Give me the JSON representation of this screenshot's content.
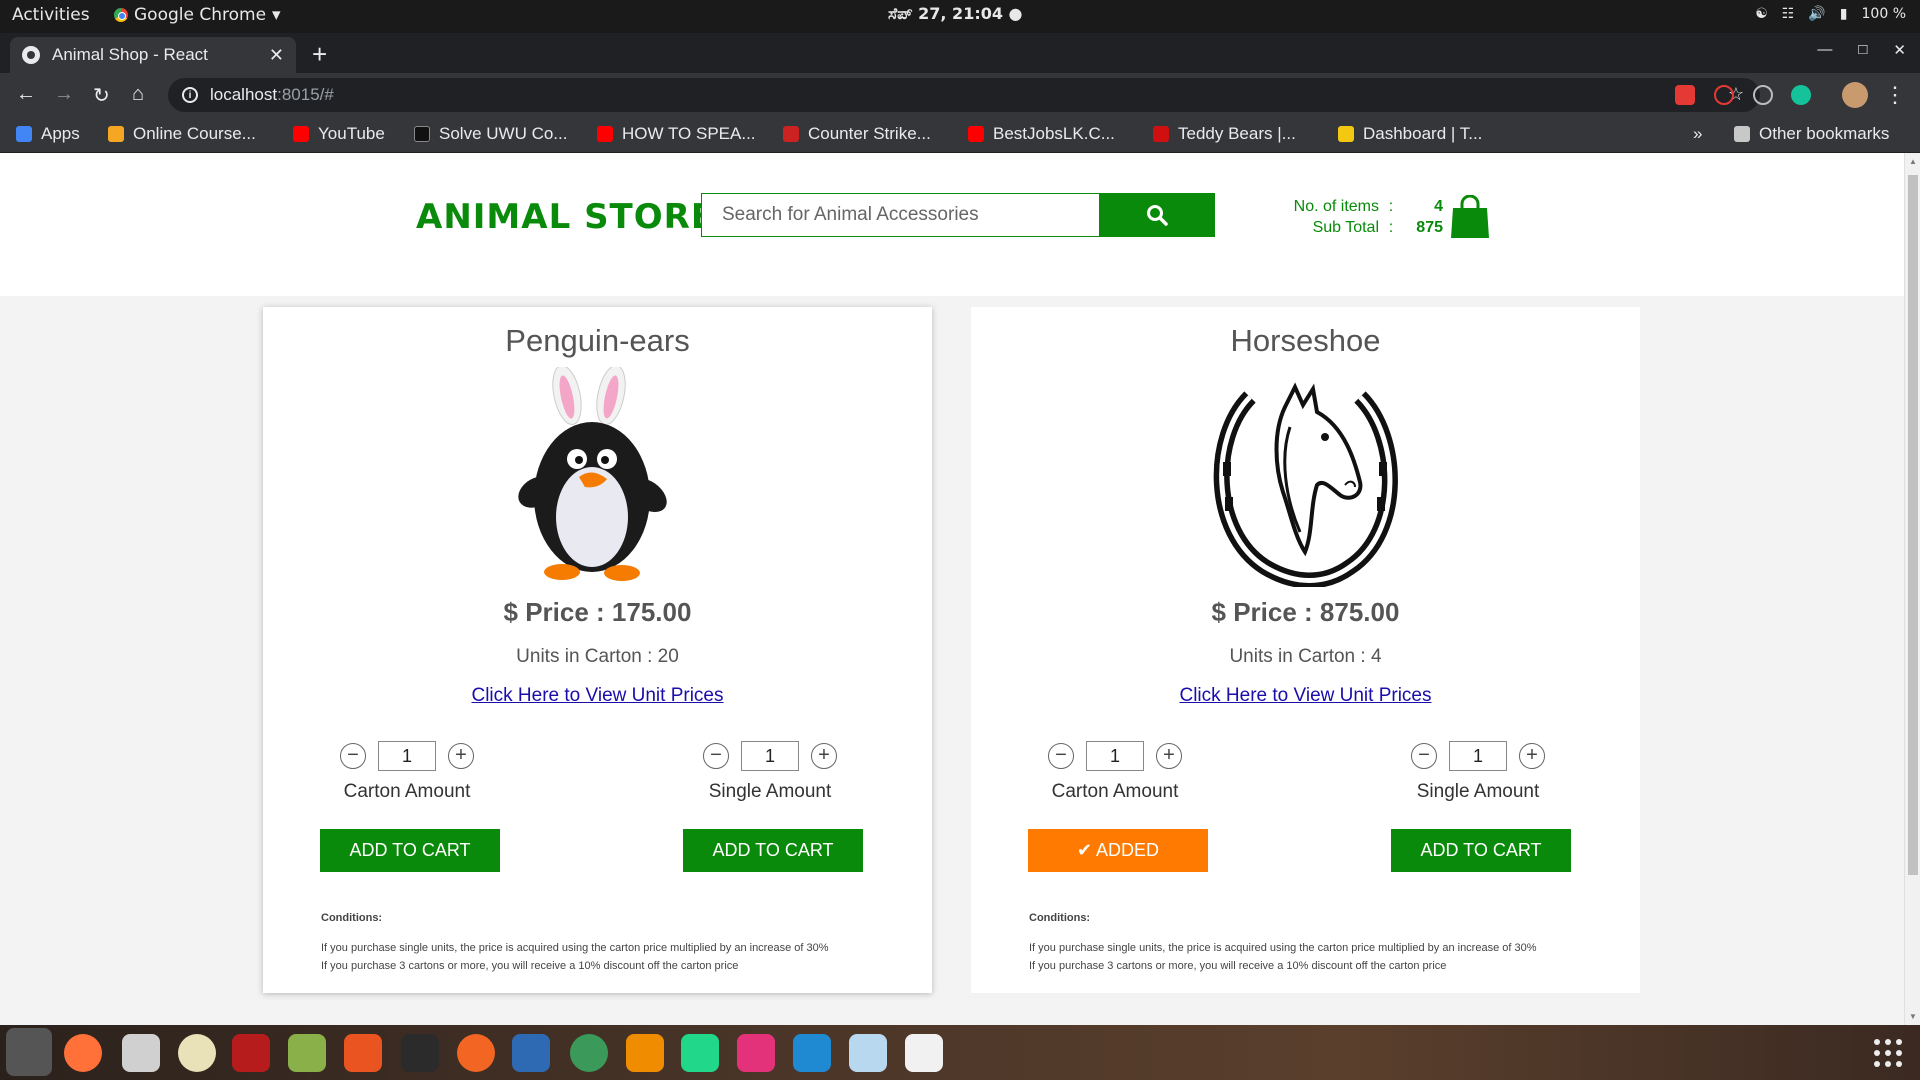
{
  "system": {
    "activities": "Activities",
    "app_name": "Google Chrome",
    "clock": "ಸೆಪ್ 27, 21:04 ●",
    "battery": "100 %"
  },
  "browser": {
    "tab_title": "Animal Shop - React",
    "url_host": "localhost",
    "url_path": ":8015/#",
    "bookmarks": [
      {
        "label": "Apps",
        "color": "#4285f4"
      },
      {
        "label": "Online Course...",
        "color": "#f5a623"
      },
      {
        "label": "YouTube",
        "color": "#ff0000"
      },
      {
        "label": "Solve UWU Co...",
        "color": "#111111"
      },
      {
        "label": "HOW TO SPEA...",
        "color": "#ff0000"
      },
      {
        "label": "Counter Strike...",
        "color": "#cc2222"
      },
      {
        "label": "BestJobsLK.C...",
        "color": "#ff0000"
      },
      {
        "label": "Teddy Bears |...",
        "color": "#d01010"
      },
      {
        "label": "Dashboard | T...",
        "color": "#f2c811"
      }
    ],
    "more": "»",
    "other_bookmarks": "Other bookmarks"
  },
  "header": {
    "logo": "ANIMAL STORE",
    "search_placeholder": "Search for Animal Accessories",
    "items_label": "No. of items",
    "items_value": "4",
    "subtotal_label": "Sub Total",
    "subtotal_value": "875",
    "colon": ":"
  },
  "products": [
    {
      "name": "Penguin-ears",
      "price": "$ Price : 175.00",
      "units": "Units in Carton : 20",
      "link": "Click Here to View Unit Prices",
      "carton_qty": "1",
      "single_qty": "1",
      "carton_label": "Carton Amount",
      "single_label": "Single Amount",
      "carton_button": "ADD TO CART",
      "single_button": "ADD TO CART",
      "conditions_title": "Conditions:",
      "condition_1": "If you purchase single units, the price is acquired using the carton price multiplied by an increase of 30%",
      "condition_2": "If you purchase 3 cartons or more, you will receive a 10% discount off the carton price"
    },
    {
      "name": "Horseshoe",
      "price": "$ Price : 875.00",
      "units": "Units in Carton : 4",
      "link": "Click Here to View Unit Prices",
      "carton_qty": "1",
      "single_qty": "1",
      "carton_label": "Carton Amount",
      "single_label": "Single Amount",
      "carton_button": "✔ ADDED",
      "single_button": "ADD TO CART",
      "conditions_title": "Conditions:",
      "condition_1": "If you purchase single units, the price is acquired using the carton price multiplied by an increase of 30%",
      "condition_2": "If you purchase 3 cartons or more, you will receive a 10% discount off the carton price"
    }
  ],
  "colors": {
    "brand_green": "#0a8a0a",
    "added_orange": "#ff7a00",
    "link_blue": "#1a0dab"
  }
}
